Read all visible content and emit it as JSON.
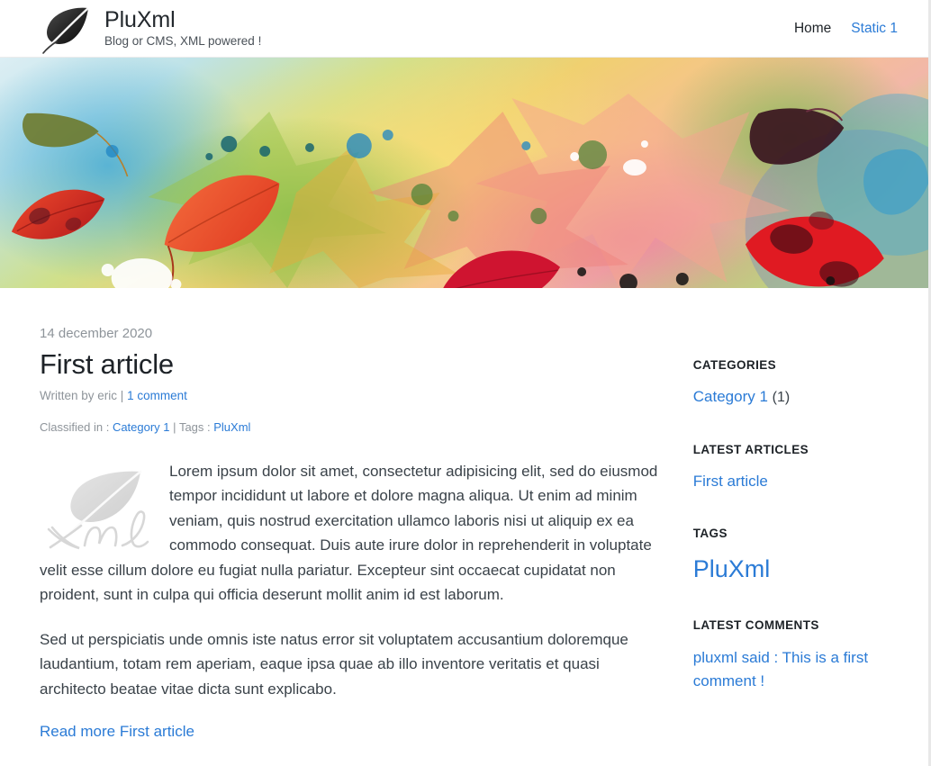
{
  "header": {
    "logo_icon": "leaf-logo-icon",
    "site_title": "PluXml",
    "tagline": "Blog or CMS, XML powered !",
    "nav": [
      {
        "label": "Home",
        "active": true
      },
      {
        "label": "Static 1",
        "active": false
      }
    ]
  },
  "banner": {
    "alt": "watercolor autumn leaves banner"
  },
  "article": {
    "date": "14 december 2020",
    "title": "First article",
    "written_by_label": "Written by eric",
    "byline_separator": "|",
    "comments_link": "1 comment",
    "classified_label": "Classified in :",
    "category_link": "Category 1",
    "classif_separator": "|",
    "tags_label": "Tags :",
    "tag_link": "PluXml",
    "thumb_icon": "xml-leaf-watermark-icon",
    "paragraph_1": "Lorem ipsum dolor sit amet, consectetur adipisicing elit, sed do eiusmod tempor incididunt ut labore et dolore magna aliqua. Ut enim ad minim veniam, quis nostrud exercitation ullamco laboris nisi ut aliquip ex ea commodo consequat. Duis aute irure dolor in reprehenderit in voluptate velit esse cillum dolore eu fugiat nulla pariatur. Excepteur sint occaecat cupidatat non proident, sunt in culpa qui officia deserunt mollit anim id est laborum.",
    "paragraph_2": "Sed ut perspiciatis unde omnis iste natus error sit voluptatem accusantium doloremque laudantium, totam rem aperiam, eaque ipsa quae ab illo inventore veritatis et quasi architecto beatae vitae dicta sunt explicabo.",
    "read_more": "Read more First article"
  },
  "sidebar": {
    "categories": {
      "title": "CATEGORIES",
      "items": [
        {
          "label": "Category 1",
          "count": "(1)"
        }
      ]
    },
    "latest_articles": {
      "title": "LATEST ARTICLES",
      "items": [
        {
          "label": "First article"
        }
      ]
    },
    "tags": {
      "title": "TAGS",
      "items": [
        {
          "label": "PluXml"
        }
      ]
    },
    "latest_comments": {
      "title": "LATEST COMMENTS",
      "items": [
        {
          "label": "pluxml said : This is a first comment !"
        }
      ]
    }
  },
  "colors": {
    "link": "#2b7bd6",
    "text": "#3a4249",
    "muted": "#8e949a",
    "heading": "#1d2227"
  }
}
